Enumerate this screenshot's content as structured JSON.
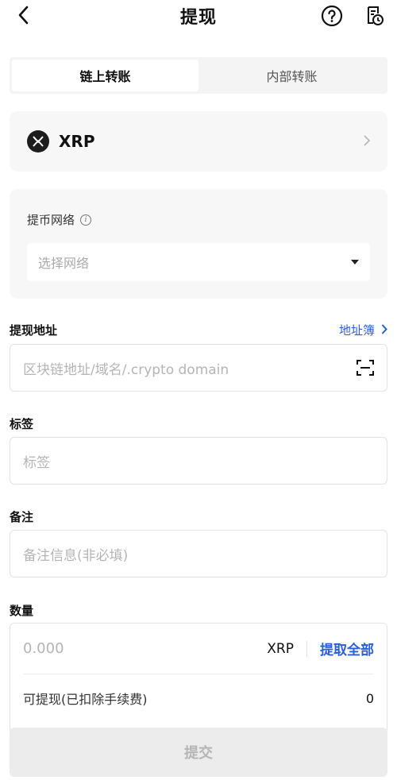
{
  "header": {
    "title": "提现"
  },
  "tabs": [
    {
      "label": "链上转账",
      "active": true
    },
    {
      "label": "内部转账",
      "active": false
    }
  ],
  "coin": {
    "symbol": "XRP"
  },
  "network": {
    "label": "提币网络",
    "placeholder": "选择网络"
  },
  "address": {
    "label": "提现地址",
    "book_link": "地址簿",
    "placeholder": "区块链地址/域名/.crypto domain"
  },
  "tag": {
    "label": "标签",
    "placeholder": "标签"
  },
  "memo": {
    "label": "备注",
    "placeholder": "备注信息(非必填)"
  },
  "amount": {
    "label": "数量",
    "placeholder": "0.000",
    "unit": "XRP",
    "max_label": "提取全部",
    "available_label": "可提现(已扣除手续费)",
    "available_value": "0"
  },
  "submit": {
    "label": "提交"
  },
  "colors": {
    "accent": "#2a5fd6",
    "card_bg": "#f7f7f7",
    "disabled_bg": "#ececec"
  }
}
